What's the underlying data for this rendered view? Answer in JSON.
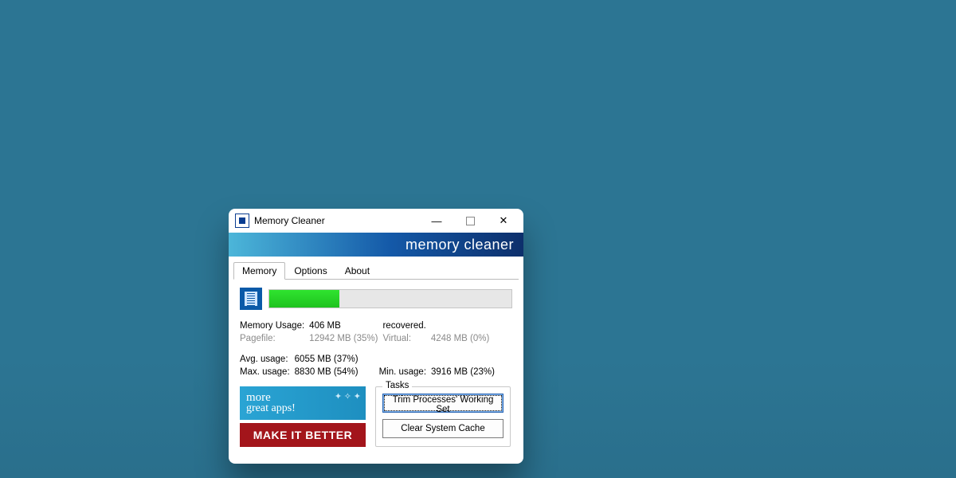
{
  "window": {
    "title": "Memory Cleaner"
  },
  "banner": {
    "text": "memory cleaner"
  },
  "tabs": [
    {
      "label": "Memory",
      "active": true
    },
    {
      "label": "Options",
      "active": false
    },
    {
      "label": "About",
      "active": false
    }
  ],
  "progress": {
    "percent": 29
  },
  "stats": {
    "memUsage": {
      "label": "Memory Usage:",
      "value": "406 MB",
      "suffix": "recovered."
    },
    "pagefile": {
      "label": "Pagefile:",
      "value": "12942 MB (35%)"
    },
    "virtual": {
      "label": "Virtual:",
      "value": "4248 MB (0%)"
    },
    "avg": {
      "label": "Avg. usage:",
      "value": "6055 MB (37%)"
    },
    "max": {
      "label": "Max. usage:",
      "value": "8830 MB (54%)"
    },
    "min": {
      "label": "Min. usage:",
      "value": "3916 MB (23%)"
    }
  },
  "ads": {
    "more1": "more",
    "more2": "great apps!",
    "better": "MAKE IT BETTER"
  },
  "tasks": {
    "legend": "Tasks",
    "trim": "Trim Processes' Working Set",
    "clear": "Clear System Cache"
  }
}
